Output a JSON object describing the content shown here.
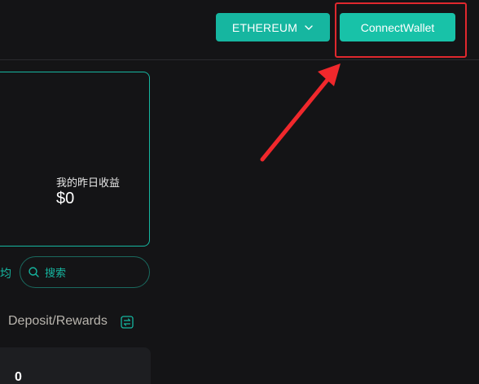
{
  "header": {
    "network_label": "ETHEREUM",
    "connect_label": "ConnectWallet"
  },
  "card": {
    "earnings_label": "我的昨日收益",
    "earnings_value": "$0"
  },
  "filter": {
    "partial_text": "均",
    "search_placeholder": "搜索"
  },
  "list": {
    "sort_label": "Deposit/Rewards",
    "first_row_value": "0"
  },
  "icons": {
    "network_dropdown": "chevron-down-icon",
    "search": "search-icon",
    "sort": "swap-icon",
    "annotation_arrow": "arrow-icon"
  },
  "colors": {
    "background": "#141416",
    "accent": "#16b6a0",
    "annotation": "#e0282e"
  }
}
